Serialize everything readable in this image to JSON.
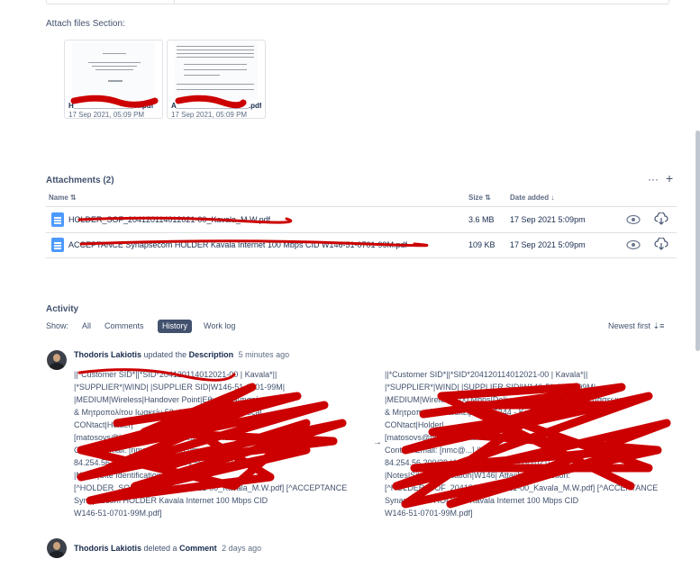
{
  "attach_files": {
    "label": "Attach files Section:",
    "files": [
      {
        "name": "H_______________W.pdf",
        "date": "17 Sep 2021, 05:09 PM"
      },
      {
        "name": "A__________________.pdf",
        "date": "17 Sep 2021, 05:09 PM"
      }
    ]
  },
  "attachments": {
    "title": "Attachments (2)",
    "more_icon": "more-icon",
    "add_icon": "plus-icon",
    "columns": {
      "name": "Name",
      "size": "Size",
      "date": "Date added"
    },
    "rows": [
      {
        "name": "HOLDER_SOF_204120114012021-00_Kavala_M.W.pdf",
        "size": "3.6 MB",
        "date": "17 Sep 2021 5:09pm"
      },
      {
        "name": "ACCEPTANCE Synapsecom HOLDER Kavala Internet 100 Mbps CID W146-51-0701-99M.pdf",
        "size": "109 KB",
        "date": "17 Sep 2021 5:09pm"
      }
    ]
  },
  "activity": {
    "title": "Activity",
    "show_label": "Show:",
    "tabs": [
      "All",
      "Comments",
      "History",
      "Work log"
    ],
    "active_tab": "History",
    "sort_label": "Newest first",
    "events": [
      {
        "user": "Thodoris Lakiotis",
        "verb": "updated the",
        "target": "Description",
        "ago": "5 minutes ago",
        "old_text": "||*Customer SID*||*SID*204120114012021-00 | Kavala*||\n|*SUPPLIER*|WIND| |SUPPLIER SID|W146-51-0701-99M|\n|MEDIUM|Wireless|Handover Point|Εθνικής Αντιστάσεων\n& Μητροπολίτου Ιωακείμ 53, 65344 - Καβάλα| |Local\nCONtact|Holder|\n[matosovs@holder.gr|mailto:matosovs@holder.gr]\nContact Email: [nmc@...|mailto:nmc@...] |LAN :\n84.254.56.200/29 | WAN: 84.254.56.1 | 2021|\n|Notes|Site Identification Code|\n[^HOLDER_SOF_204120114012021-00_Kavala_M.W.pdf] [^ACCEPTANCE\nSynapsecom HOLDER Kavala Internet 100 Mbps CID\nW146-51-0701-99M.pdf]",
        "new_text": "||*Customer SID*||*SID*204120114012021-00 | Kavala*||\n|*SUPPLIER*|WIND| |SUPPLIER SID|W146-51-0701-99M|\n|MEDIUM|Wireless|100 Mbps|Delivery Point|Εθνικής Αντιστάσεων\n& Μητροπολίτου Ιωακείμ 53, 65344 - Καβάλα| |Local\nCONtact|Holder|\n[matosovs@holder.gr|mailto:matosovs@holder.gr]\nContact Email: [nmc@...] |LAN :\n84.254.56.200/29 |Activation date|17/03/2021|\n|Notes|Site Identification|W146| Attach files Section:\n[^HOLDER_SOF_204120114012021-00_Kavala_M.W.pdf] [^ACCEPTANCE\nSynapsecom HOLDER Kavala Internet 100 Mbps CID\nW146-51-0701-99M.pdf]"
      },
      {
        "user": "Thodoris Lakiotis",
        "verb": "deleted a",
        "target": "Comment",
        "ago": "2 days ago"
      }
    ]
  },
  "colors": {
    "accent": "#42526e",
    "file_icon": "#4c9aff",
    "redaction": "#cc0000"
  }
}
